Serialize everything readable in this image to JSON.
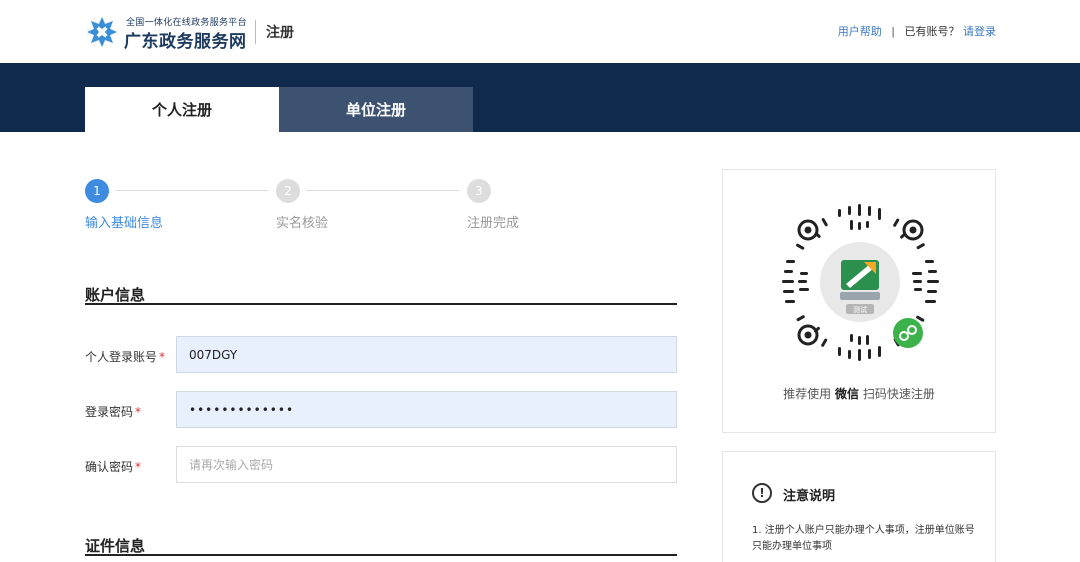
{
  "header": {
    "logo_subtitle": "全国一体化在线政务服务平台",
    "logo_title": "广东政务服务网",
    "page_title": "注册",
    "help_link": "用户帮助",
    "have_account_text": "已有账号？",
    "login_link": "请登录",
    "separator": "|"
  },
  "tabs": [
    {
      "label": "个人注册",
      "active": true
    },
    {
      "label": "单位注册",
      "active": false
    }
  ],
  "steps": [
    {
      "number": "1",
      "label": "输入基础信息",
      "active": true
    },
    {
      "number": "2",
      "label": "实名核验",
      "active": false
    },
    {
      "number": "3",
      "label": "注册完成",
      "active": false
    }
  ],
  "account_section": {
    "title": "账户信息",
    "fields": [
      {
        "label": "个人登录账号",
        "required_mark": "*",
        "value": "007DGY",
        "placeholder": "",
        "type": "text"
      },
      {
        "label": "登录密码",
        "required_mark": "*",
        "value": "•••••••••••••",
        "placeholder": "",
        "type": "text"
      },
      {
        "label": "确认密码",
        "required_mark": "*",
        "value": "",
        "placeholder": "请再次输入密码",
        "type": "password"
      }
    ]
  },
  "id_section": {
    "title": "证件信息"
  },
  "qr": {
    "caption_prefix": "推荐使用",
    "caption_bold": "微信",
    "caption_suffix": "扫码快速注册",
    "center_label": "测试"
  },
  "notice": {
    "icon": "!",
    "title": "注意说明",
    "text": "1. 注册个人账户只能办理个人事项，注册单位账号只能办理单位事项"
  },
  "colors": {
    "brand_dark": "#0f2a4c",
    "accent_blue": "#3e8be0",
    "required_red": "#d9333c",
    "wechat_green": "#3cb34a"
  }
}
